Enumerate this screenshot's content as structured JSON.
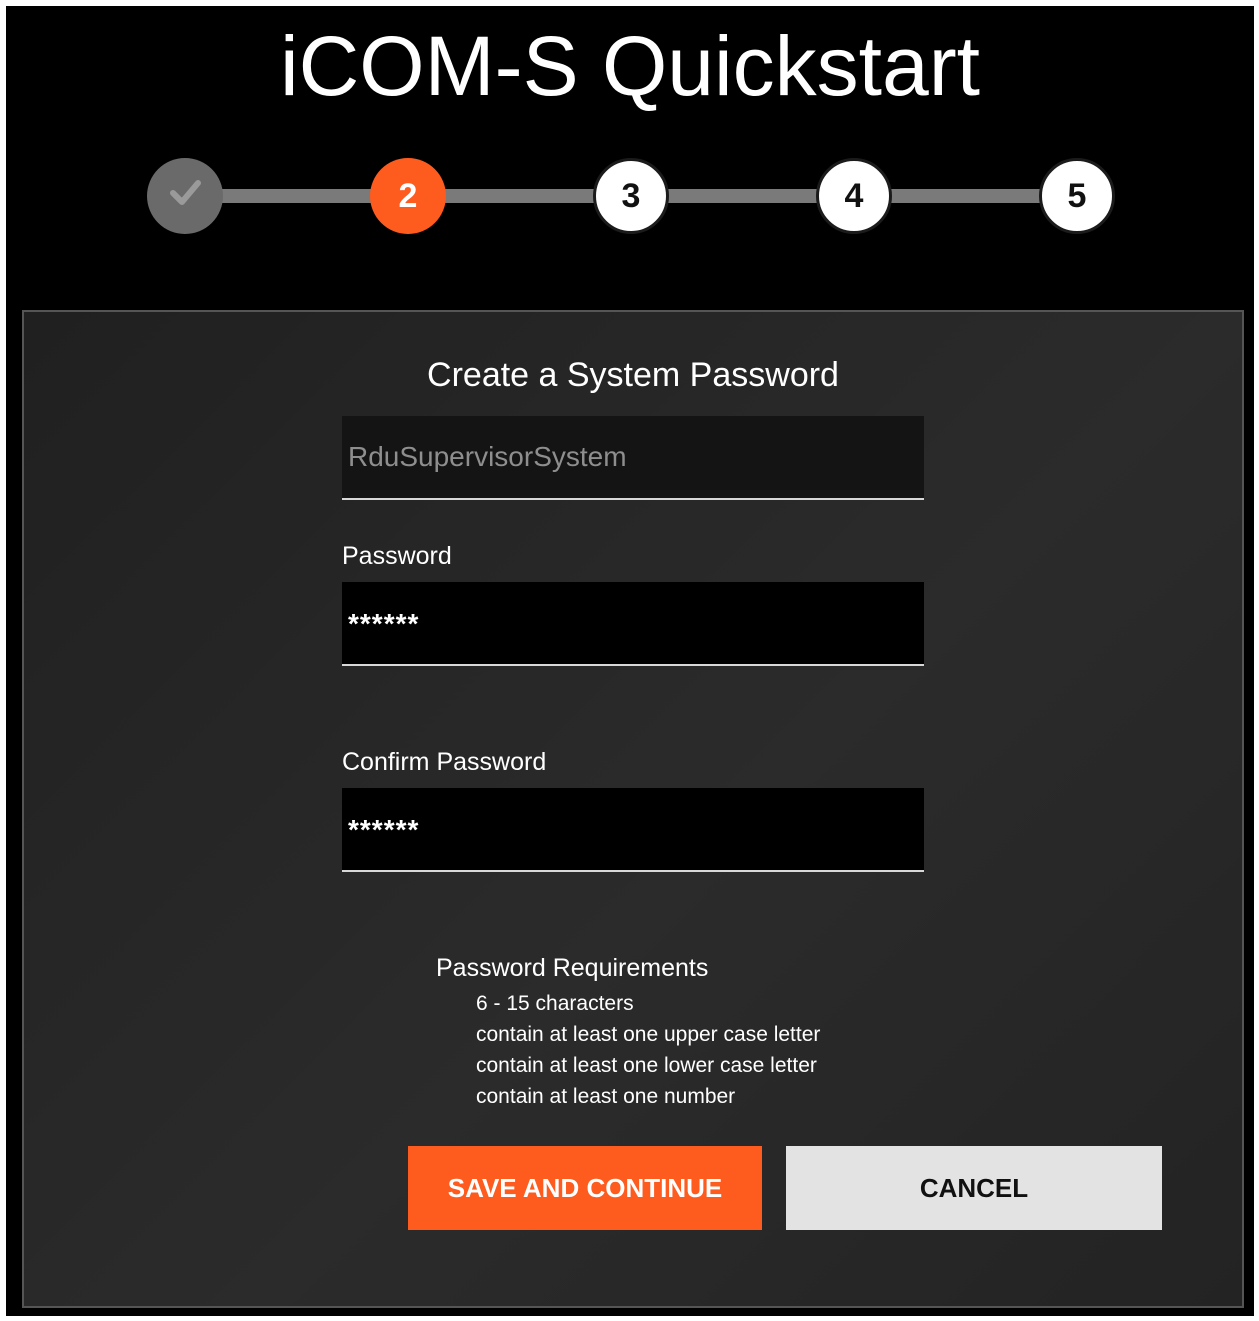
{
  "app": {
    "title": "iCOM-S Quickstart"
  },
  "stepper": {
    "steps": [
      {
        "label": "",
        "state": "completed",
        "icon": "check-icon"
      },
      {
        "label": "2",
        "state": "current"
      },
      {
        "label": "3",
        "state": "pending"
      },
      {
        "label": "4",
        "state": "pending"
      },
      {
        "label": "5",
        "state": "pending"
      }
    ],
    "colors": {
      "current": "#fe5b1e",
      "completed": "#6a6a6a",
      "track": "#7a7a7a"
    }
  },
  "form": {
    "heading": "Create a System Password",
    "username": {
      "value": "RduSupervisorSystem"
    },
    "password": {
      "label": "Password",
      "value": "******"
    },
    "confirm_password": {
      "label": "Confirm Password",
      "value": "******"
    },
    "requirements": {
      "title": "Password Requirements",
      "items": [
        "6 - 15 characters",
        "contain at least one upper case letter",
        "contain at least one lower case letter",
        "contain at least one number"
      ]
    },
    "buttons": {
      "save_label": "SAVE AND CONTINUE",
      "cancel_label": "CANCEL"
    }
  },
  "colors": {
    "accent": "#fe5b1e",
    "cancel_bg": "#e3e3e3"
  }
}
